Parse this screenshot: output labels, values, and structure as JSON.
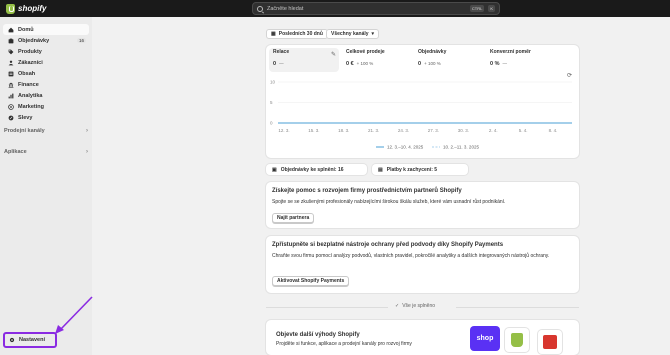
{
  "topbar": {
    "brand": "shopify",
    "search_placeholder": "Začněte hledat",
    "shortcut_ctrl": "CTRL",
    "shortcut_key": "K"
  },
  "sidebar": {
    "items": [
      {
        "label": "Domů",
        "icon": "home-icon",
        "active": true
      },
      {
        "label": "Objednávky",
        "icon": "orders-icon",
        "badge": "16"
      },
      {
        "label": "Produkty",
        "icon": "tag-icon"
      },
      {
        "label": "Zákazníci",
        "icon": "person-icon"
      },
      {
        "label": "Obsah",
        "icon": "content-icon"
      },
      {
        "label": "Finance",
        "icon": "bank-icon"
      },
      {
        "label": "Analytika",
        "icon": "chart-icon"
      },
      {
        "label": "Marketing",
        "icon": "target-icon"
      },
      {
        "label": "Slevy",
        "icon": "discount-icon"
      }
    ],
    "sections": [
      {
        "label": "Prodejní kanály"
      },
      {
        "label": "Aplikace"
      }
    ],
    "settings_label": "Nastavení"
  },
  "filters": {
    "period": "Posledních 30 dnů",
    "channels": "Všechny kanály"
  },
  "metrics": [
    {
      "label": "Relace",
      "value": "0",
      "change": "—"
    },
    {
      "label": "Celkové prodeje",
      "value": "0 €",
      "change": "+ 100 %"
    },
    {
      "label": "Objednávky",
      "value": "0",
      "change": "+ 100 %"
    },
    {
      "label": "Konverzní poměr",
      "value": "0 %",
      "change": "—"
    }
  ],
  "chart_data": {
    "type": "line",
    "title": "",
    "xlabel": "",
    "ylabel": "",
    "ylim": [
      0,
      10
    ],
    "yticks": [
      "10",
      "5",
      "0"
    ],
    "categories": [
      "12. 3.",
      "15. 3.",
      "18. 3.",
      "21. 3.",
      "24. 3.",
      "27. 3.",
      "30. 3.",
      "2. 4.",
      "5. 4.",
      "8. 4."
    ],
    "series": [
      {
        "name": "12. 3.–10. 4. 2025",
        "values": [
          0,
          0,
          0,
          0,
          0,
          0,
          0,
          0,
          0,
          0
        ],
        "color": "#4a9fd6"
      },
      {
        "name": "10. 2.–11. 3. 2025",
        "values": [
          0,
          0,
          0,
          0,
          0,
          0,
          0,
          0,
          0,
          0
        ],
        "color": "#a9d0ec"
      }
    ],
    "grid": true,
    "legend": "bottom"
  },
  "tasks": {
    "orders_to_fulfill": "Objednávky ke splnění: 16",
    "payments_to_capture": "Platby k zachycení: 5"
  },
  "partner_card": {
    "title": "Získejte pomoc s rozvojem firmy prostřednictvím partnerů Shopify",
    "text": "Spojte se se zkušenými profesionály nabízejícími širokou škálu služeb, které vám usnadní růst podnikání.",
    "button": "Najít partnera"
  },
  "fraud_card": {
    "title": "Zpřístupněte si bezplatné nástroje ochrany před podvody díky Shopify Payments",
    "text": "Chraňte svou firmu pomocí analýzy podvodů, vlastních pravidel, pokročilé analytiky a dalších integrovaných nástrojů ochrany.",
    "button": "Aktivovat Shopify Payments"
  },
  "done_label": "Vše je splněno",
  "promo_card": {
    "title": "Objevte další výhody Shopify",
    "text": "Projděte si funkce, aplikace a prodejní kanály pro rozvoj firmy",
    "shop_label": "shop",
    "colors": {
      "shop": "#5a31f4",
      "shopify": "#95bf47",
      "red": "#d8362e"
    }
  }
}
